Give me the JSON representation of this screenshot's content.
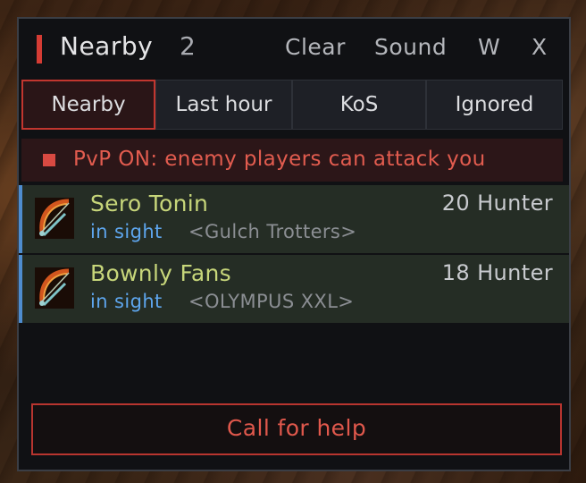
{
  "header": {
    "title": "Nearby",
    "count": "2",
    "buttons": {
      "clear": "Clear",
      "sound": "Sound",
      "w": "W",
      "x": "X"
    }
  },
  "tabs": [
    {
      "label": "Nearby",
      "active": true
    },
    {
      "label": "Last hour",
      "active": false
    },
    {
      "label": "KoS",
      "active": false
    },
    {
      "label": "Ignored",
      "active": false
    }
  ],
  "alert": {
    "text": "PvP ON: enemy players can attack you"
  },
  "players": [
    {
      "name": "Sero Tonin",
      "level_class": "20 Hunter",
      "status": "in sight",
      "guild": "<Gulch Trotters>",
      "icon": "hunter-bow-icon"
    },
    {
      "name": "Bownly Fans",
      "level_class": "18 Hunter",
      "status": "in sight",
      "guild": "<OLYMPUS XXL>",
      "icon": "hunter-bow-icon"
    }
  ],
  "help_button": {
    "label": "Call for help"
  },
  "colors": {
    "accent": "#d53c34",
    "panel": "#101114",
    "player_name": "#c7d67a",
    "status": "#5ea6ee",
    "row_marker": "#4e8ccf"
  }
}
